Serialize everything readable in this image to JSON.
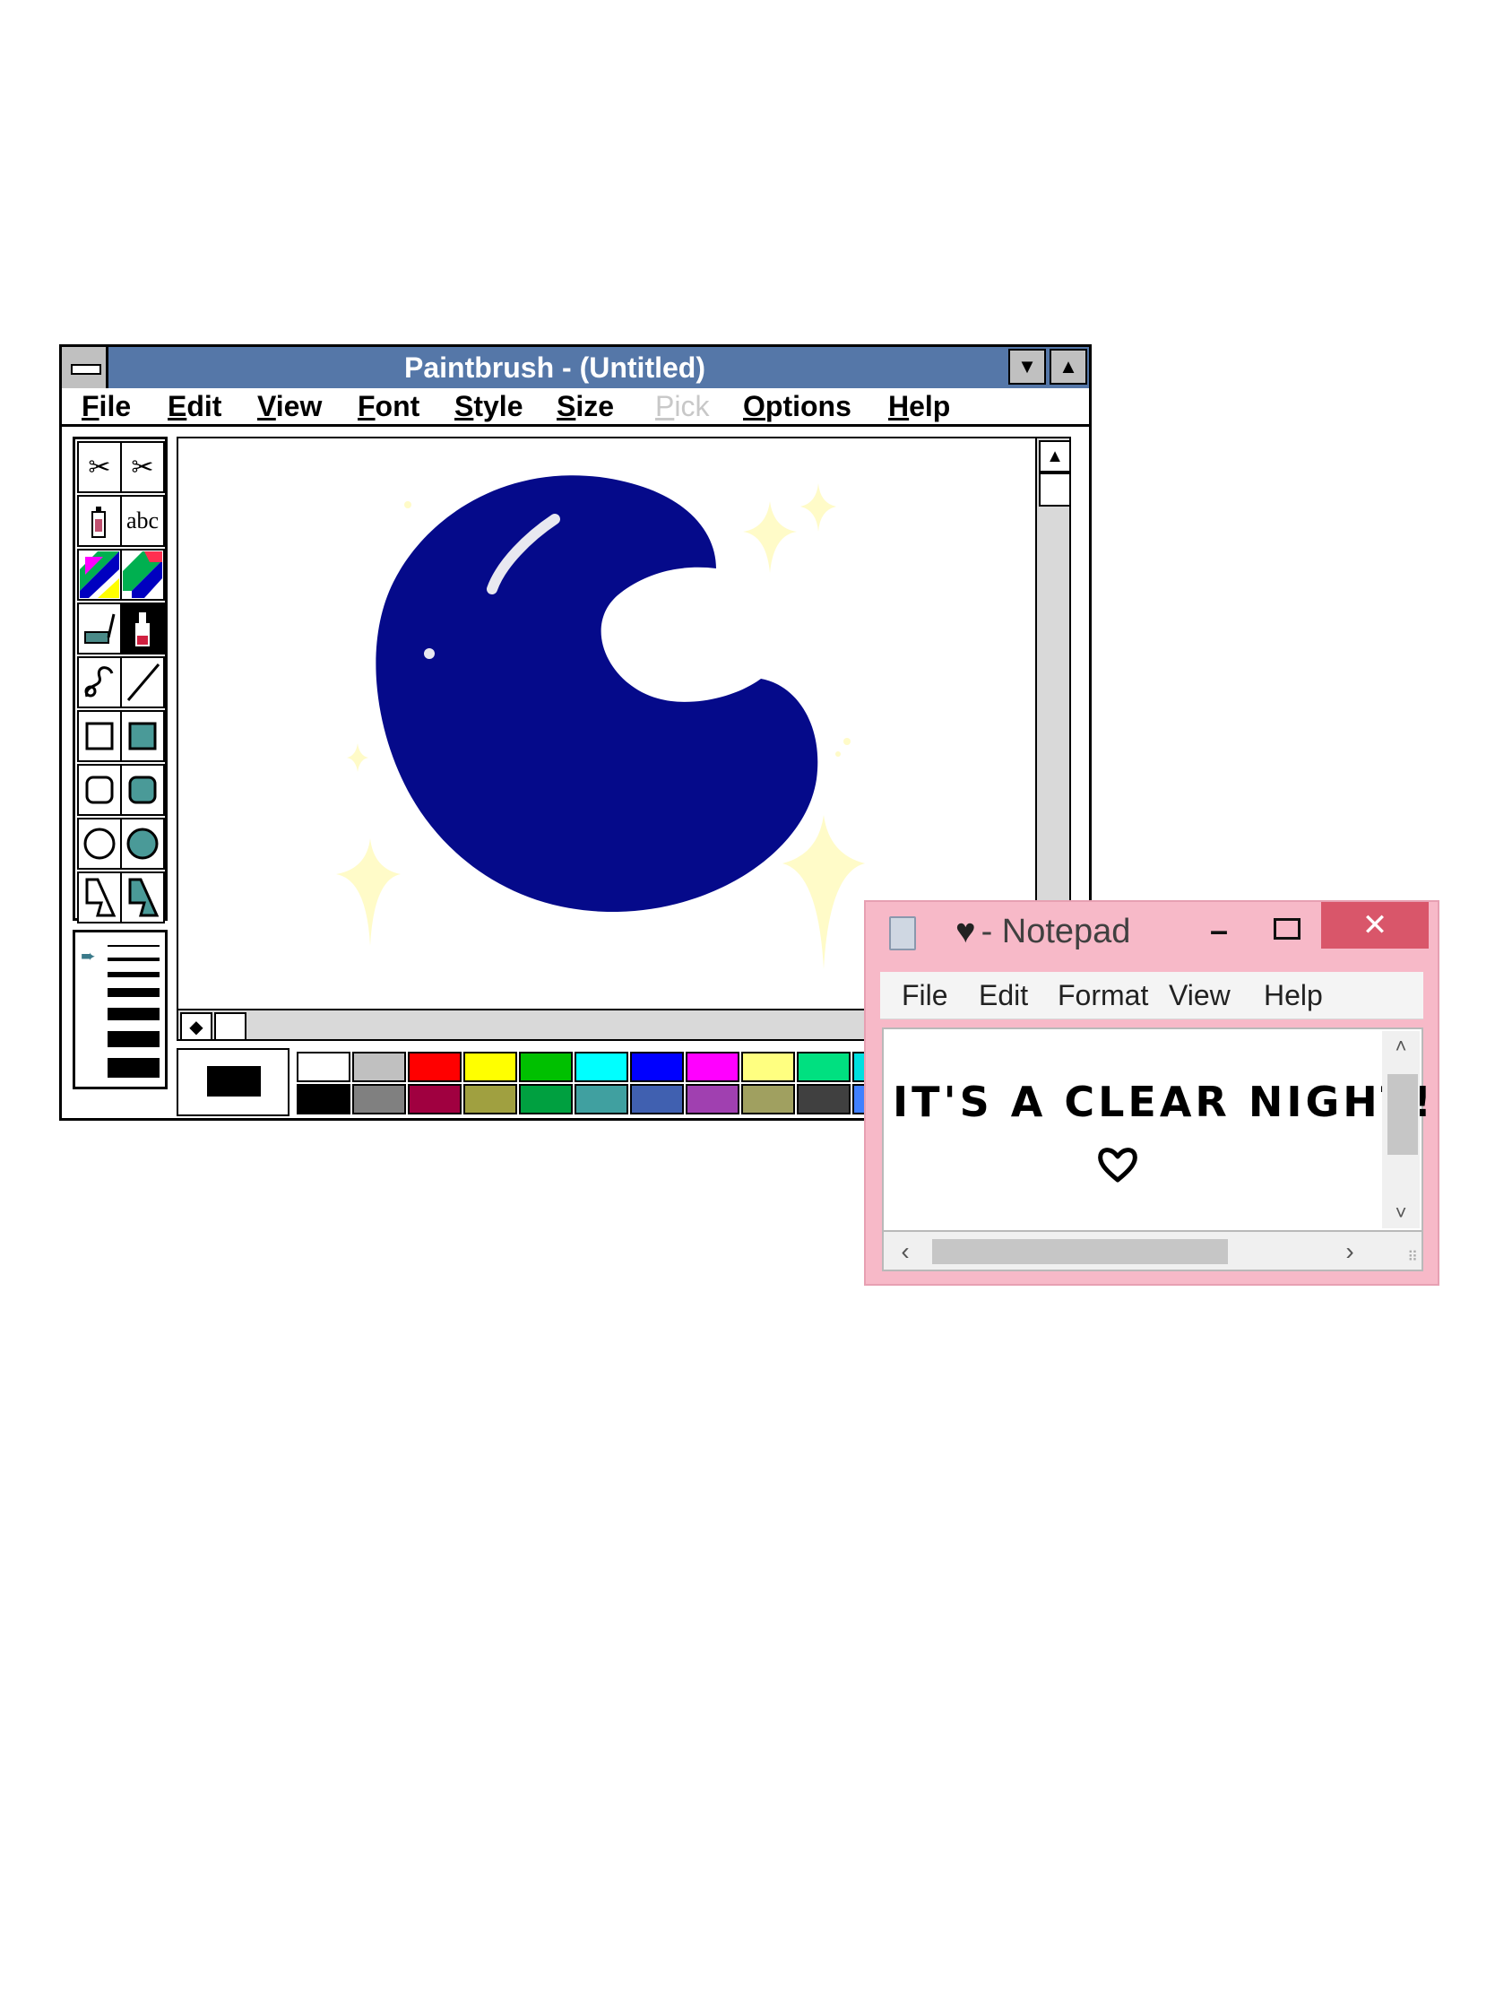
{
  "paintbrush": {
    "title": "Paintbrush - (Untitled)",
    "menu": [
      "File",
      "Edit",
      "View",
      "Font",
      "Style",
      "Size",
      "Pick",
      "Options",
      "Help"
    ],
    "disabled_menu": "Pick",
    "text_tool_label": "abc",
    "current_color": "#000000",
    "palette_top": [
      "#ffffff",
      "#c0c0c0",
      "#ff0000",
      "#ffff00",
      "#00c000",
      "#00ffff",
      "#0000ff",
      "#ff00ff",
      "#ffff80",
      "#00e080",
      "#00e0e0"
    ],
    "palette_bottom": [
      "#000000",
      "#808080",
      "#a00040",
      "#a0a040",
      "#00a040",
      "#40a0a0",
      "#4060b0",
      "#a040b0",
      "#a0a060",
      "#404040",
      "#4080ff"
    ],
    "drawing": {
      "moon_color": "#050a8a",
      "sparkle_color": "#fffbc8"
    }
  },
  "notepad": {
    "title_prefix": "♥",
    "title": "- Notepad",
    "menu": [
      "File",
      "Edit",
      "Format",
      "View",
      "Help"
    ],
    "content": "IT'S A CLEAR NIGHT!",
    "titlebar_color": "#f7b9c8",
    "close_color": "#d9566a"
  }
}
